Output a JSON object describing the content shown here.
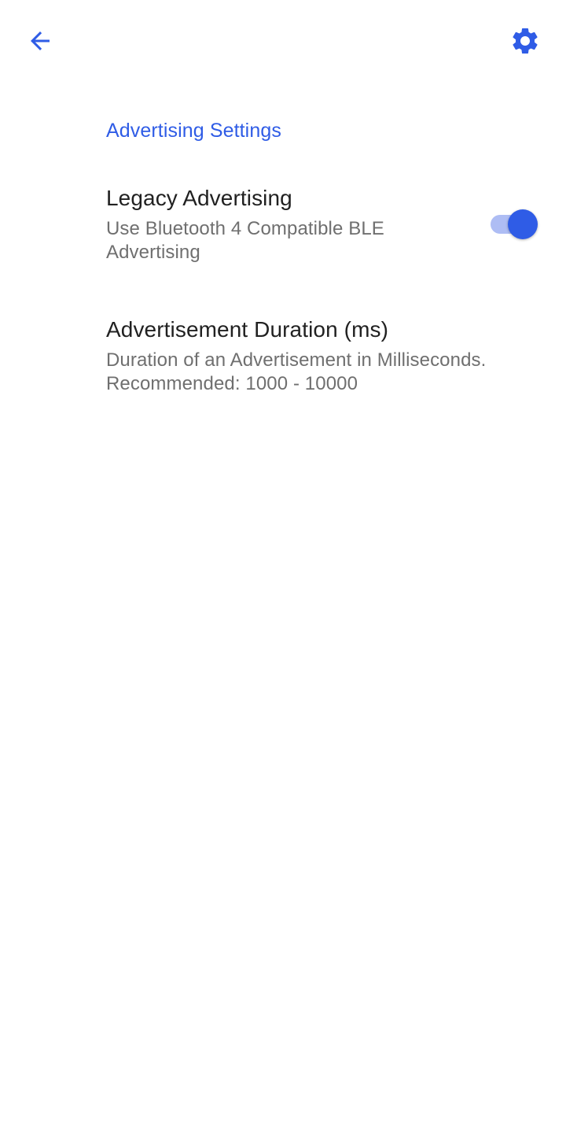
{
  "toolbar": {
    "back_icon": "arrow-back-icon",
    "settings_icon": "gear-icon"
  },
  "section": {
    "header": "Advertising Settings"
  },
  "preferences": [
    {
      "title": "Legacy Advertising",
      "summary": "Use Bluetooth 4 Compatible BLE Advertising",
      "toggle": true
    },
    {
      "title": "Advertisement Duration (ms)",
      "summary": "Duration of an Advertisement in Milliseconds. Recommended: 1000 - 10000"
    }
  ],
  "colors": {
    "accent": "#2f5ce6",
    "switch_track": "#aebdf4",
    "title_text": "#212121",
    "summary_text": "#6f6f6f",
    "background": "#ffffff"
  }
}
